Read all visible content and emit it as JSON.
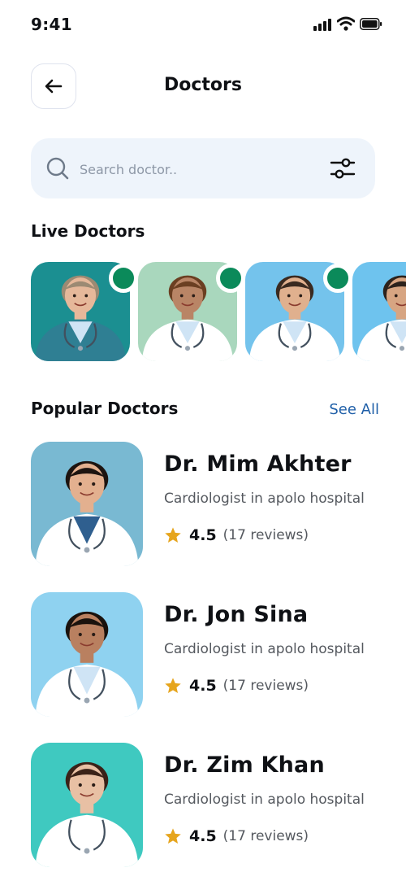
{
  "status_bar": {
    "time": "9:41"
  },
  "header": {
    "title": "Doctors"
  },
  "search": {
    "placeholder": "Search doctor.."
  },
  "live_section": {
    "title": "Live Doctors",
    "doctors": [
      {
        "bg": "#1b8f91",
        "coat": "#2f7f93",
        "skin": "#e6b89a",
        "hair": "#9c8a73",
        "live": true
      },
      {
        "bg": "#a9d7bd",
        "coat": "#ffffff",
        "skin": "#b98566",
        "hair": "#6b3f22",
        "live": true
      },
      {
        "bg": "#74c3ec",
        "coat": "#ffffff",
        "skin": "#e0b08e",
        "hair": "#3a2a20",
        "live": true
      },
      {
        "bg": "#6ec3ee",
        "coat": "#ffffff",
        "skin": "#d7a582",
        "hair": "#2c221c",
        "live": false
      }
    ]
  },
  "popular_section": {
    "title": "Popular Doctors",
    "see_all": "See All",
    "doctors": [
      {
        "name": "Dr. Mim Akhter",
        "specialty": "Cardiologist in apolo hospital",
        "rating": "4.5",
        "reviews": "(17 reviews)",
        "bg": "#79b9d2",
        "coat": "#ffffff",
        "shirt": "#2f5f8f",
        "skin": "#e3b08f",
        "hair": "#1d1410"
      },
      {
        "name": "Dr. Jon Sina",
        "specialty": "Cardiologist in apolo hospital",
        "rating": "4.5",
        "reviews": "(17 reviews)",
        "bg": "#8fd2f0",
        "coat": "#ffffff",
        "shirt": "#cfe4f5",
        "skin": "#b98060",
        "hair": "#1a120d"
      },
      {
        "name": "Dr. Zim Khan",
        "specialty": "Cardiologist in apolo hospital",
        "rating": "4.5",
        "reviews": "(17 reviews)",
        "bg": "#3fc9c0",
        "coat": "#ffffff",
        "shirt": "#ffffff",
        "skin": "#e8c0a4",
        "hair": "#3a2218"
      }
    ]
  },
  "colors": {
    "accent": "#1f5fa8",
    "live_dot": "#0b8a5a",
    "star": "#e6a51d",
    "search_bg": "#eef4fb"
  },
  "icons": [
    "back-arrow-icon",
    "search-icon",
    "filter-icon",
    "star-icon"
  ]
}
